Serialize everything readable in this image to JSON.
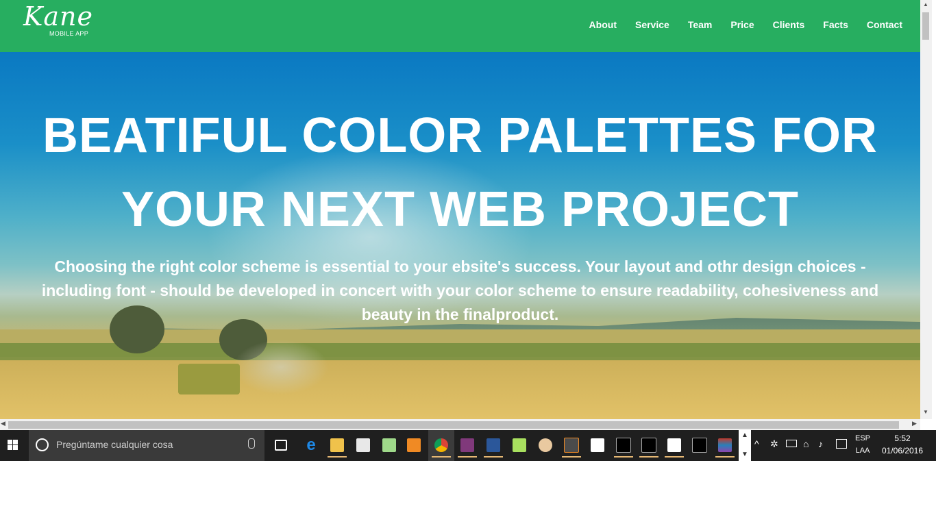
{
  "brand": {
    "name": "Kane",
    "subtitle": "MOBILE APP"
  },
  "nav": [
    "About",
    "Service",
    "Team",
    "Price",
    "Clients",
    "Facts",
    "Contact"
  ],
  "hero": {
    "title_line1": "BEATIFUL COLOR PALETTES FOR",
    "title_line2": "YOUR NEXT WEB PROJECT",
    "text": "Choosing the right color scheme is essential to your ebsite's success. Your layout and othr design choices - including font - should be developed in concert with your color scheme to ensure readability, cohesiveness and beauty in the finalproduct."
  },
  "colors": {
    "navbar": "#27ae60",
    "taskbar": "#1f1f1f"
  },
  "taskbar": {
    "search_placeholder": "Pregúntame cualquier cosa",
    "apps": [
      "task-view-icon",
      "edge-icon",
      "file-explorer-icon",
      "store-icon",
      "maps-icon",
      "media-player-icon",
      "chrome-icon",
      "onenote-icon",
      "word-icon",
      "app-green-icon",
      "app-hand-icon",
      "sublime-text-icon",
      "slack-icon",
      "terminal-icon",
      "terminal-icon",
      "photos-icon",
      "cmd-icon",
      "winrar-icon"
    ],
    "language": {
      "code": "ESP",
      "layout": "LAA"
    },
    "clock": {
      "time": "5:52",
      "date": "01/06/2016"
    }
  }
}
